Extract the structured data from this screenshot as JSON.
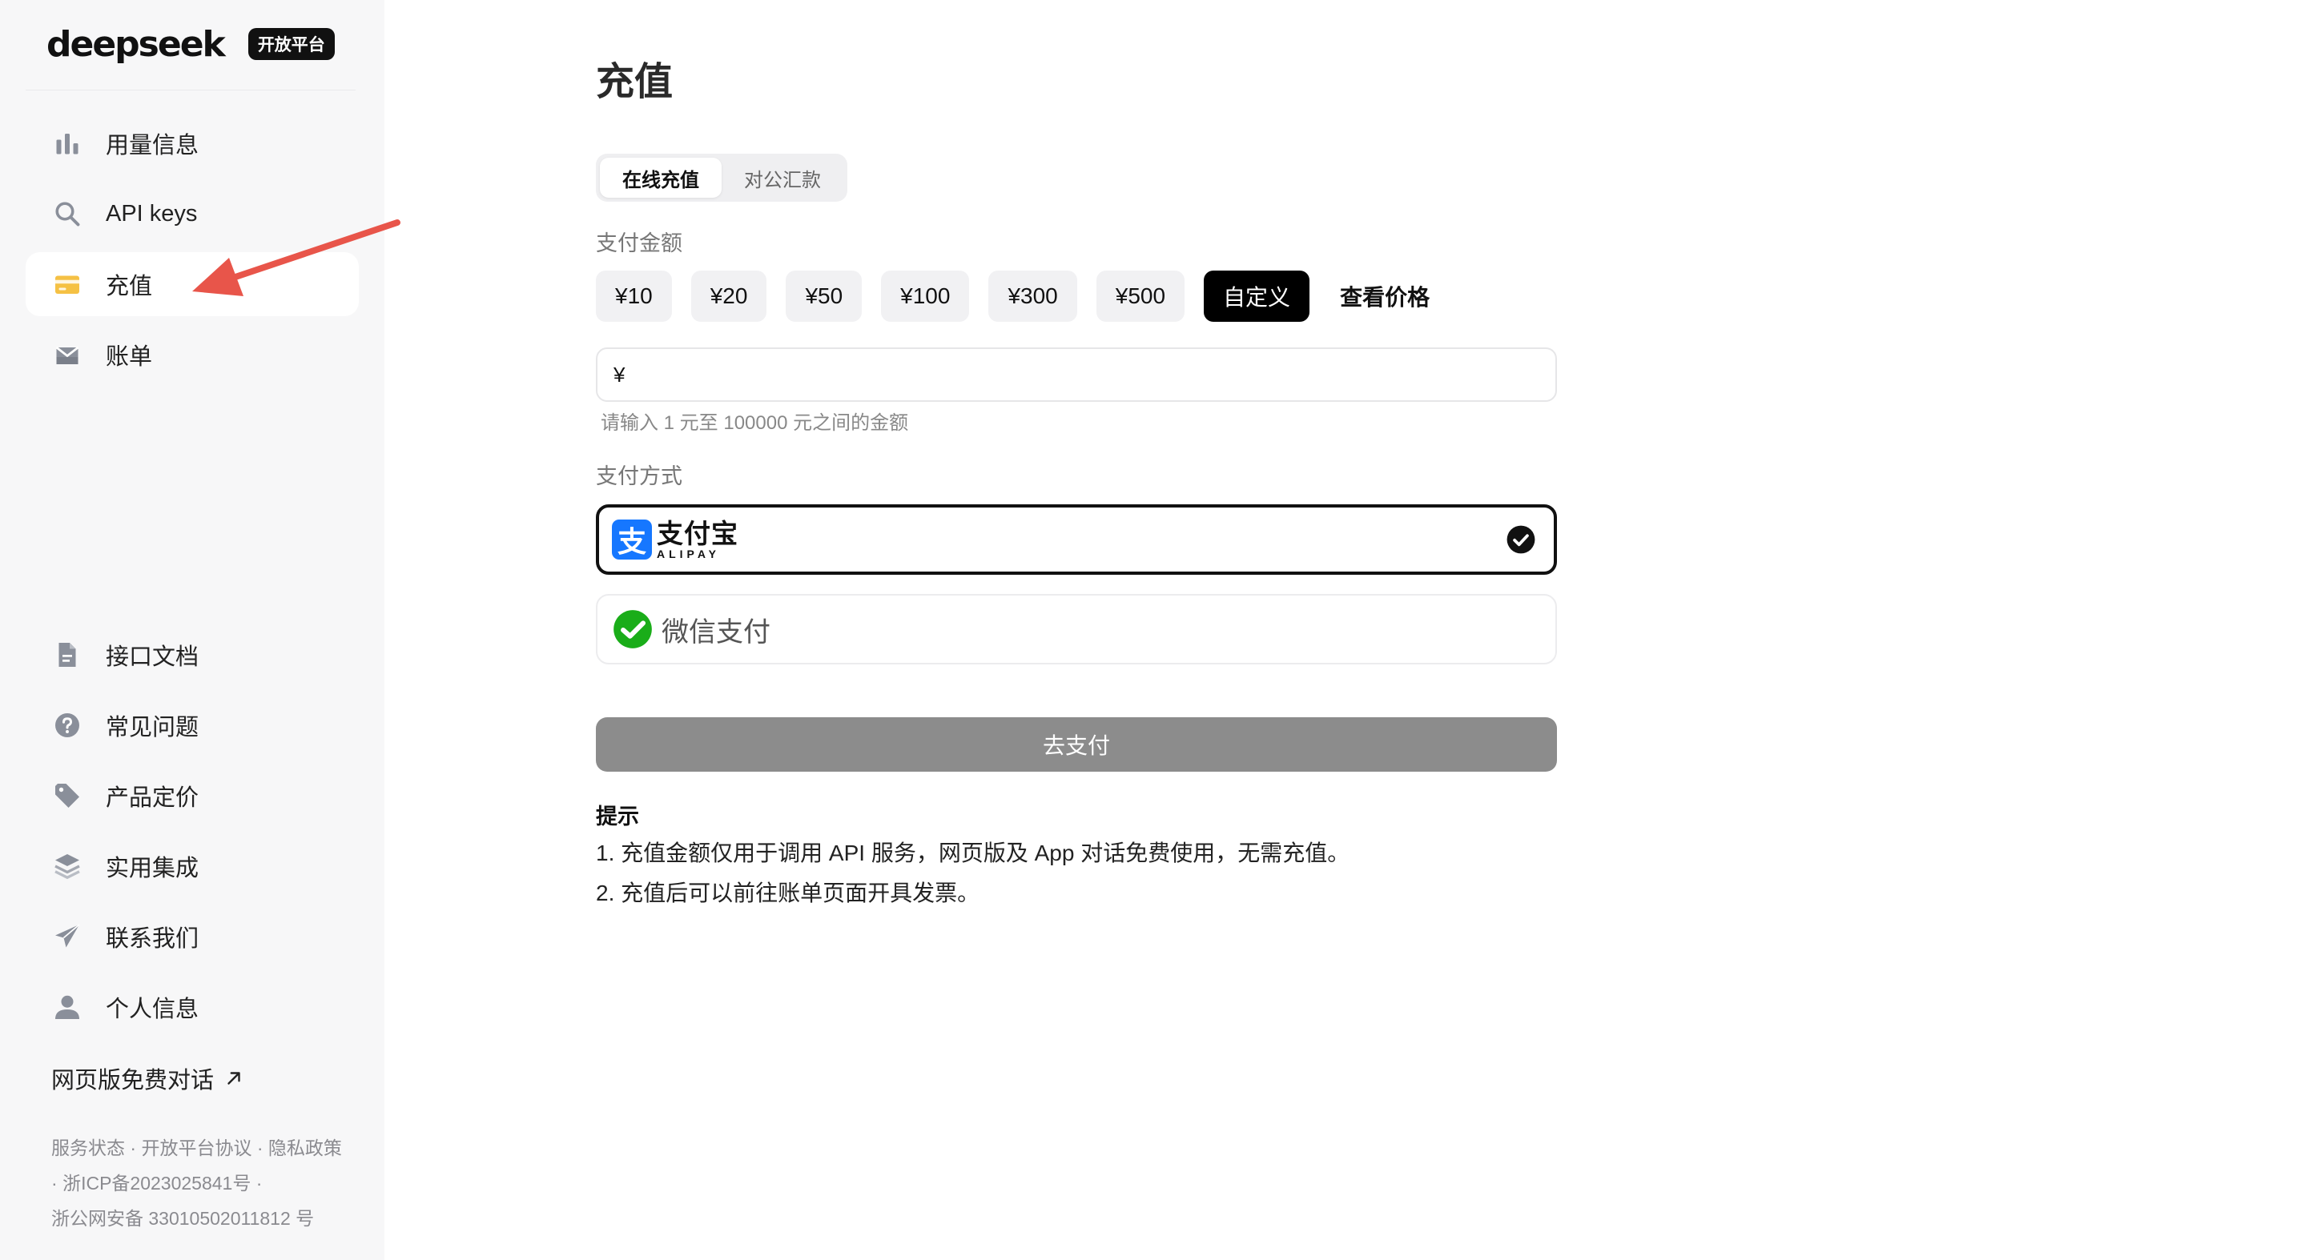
{
  "brand": {
    "name": "deepseek",
    "badge": "开放平台"
  },
  "sidebar": {
    "top_items": [
      {
        "label": "用量信息",
        "icon": "bar-chart-icon"
      },
      {
        "label": "API keys",
        "icon": "search-key-icon"
      },
      {
        "label": "充值",
        "icon": "card-icon",
        "active": true
      },
      {
        "label": "账单",
        "icon": "inbox-icon"
      }
    ],
    "bottom_items": [
      {
        "label": "接口文档",
        "icon": "document-icon"
      },
      {
        "label": "常见问题",
        "icon": "question-icon"
      },
      {
        "label": "产品定价",
        "icon": "tag-icon"
      },
      {
        "label": "实用集成",
        "icon": "layers-icon"
      },
      {
        "label": "联系我们",
        "icon": "paper-plane-icon"
      },
      {
        "label": "个人信息",
        "icon": "user-icon"
      }
    ],
    "web_chat_link": "网页版免费对话",
    "footer": {
      "service_status": "服务状态",
      "platform_agreement": "开放平台协议",
      "privacy_policy": "隐私政策",
      "icp": "浙ICP备2023025841号",
      "police": "浙公网安备 33010502011812 号"
    }
  },
  "main": {
    "title": "充值",
    "tabs": [
      {
        "label": "在线充值",
        "active": true
      },
      {
        "label": "对公汇款",
        "active": false
      }
    ],
    "amount_label": "支付金额",
    "amount_options": [
      {
        "label": "¥10"
      },
      {
        "label": "¥20"
      },
      {
        "label": "¥50"
      },
      {
        "label": "¥100"
      },
      {
        "label": "¥300"
      },
      {
        "label": "¥500"
      },
      {
        "label": "自定义",
        "selected": true
      }
    ],
    "price_link": "查看价格",
    "custom_amount": {
      "currency": "¥",
      "value": "",
      "hint": "请输入 1 元至 100000 元之间的金额"
    },
    "payment_label": "支付方式",
    "payment_methods": {
      "alipay": {
        "cn": "支付宝",
        "en": "ALIPAY",
        "mark": "支",
        "selected": true
      },
      "wechat": {
        "label": "微信支付",
        "selected": false
      }
    },
    "submit_label": "去支付",
    "tips": {
      "title": "提示",
      "lines": [
        "1. 充值金额仅用于调用 API 服务，网页版及 App 对话免费使用，无需充值。",
        "2. 充值后可以前往账单页面开具发票。"
      ]
    }
  },
  "colors": {
    "sidebar_bg": "#f7f7f8",
    "accent_black": "#000000",
    "submit_disabled": "#8c8c8c",
    "alipay_blue": "#1677ff",
    "wechat_green": "#1aad19",
    "card_icon_yellow": "#f5c144",
    "annotation_red": "#e8554a"
  }
}
